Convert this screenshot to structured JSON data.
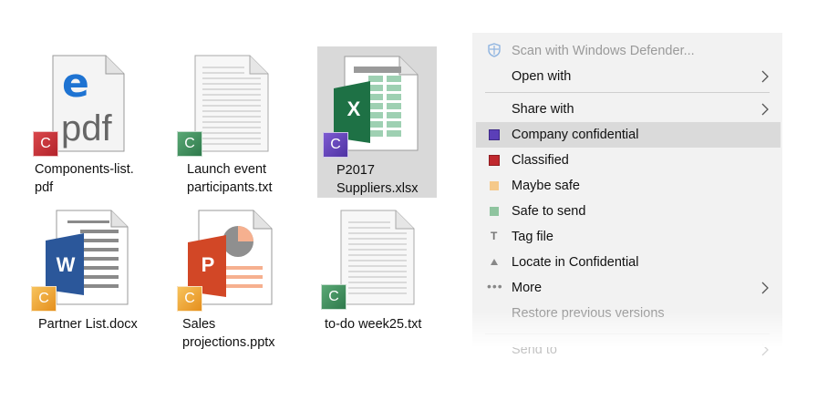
{
  "files": [
    {
      "name": "Components-list.\npdf",
      "badge": "C",
      "badge_color": "#c0282e",
      "type": "pdf",
      "pdf_text": "pdf",
      "selected": false
    },
    {
      "name": "Launch event\nparticipants.txt",
      "badge": "C",
      "badge_color": "#3c8a58",
      "type": "txt",
      "selected": false
    },
    {
      "name": "P2017\nSuppliers.xlsx",
      "badge": "C",
      "badge_color": "#5b3fb8",
      "type": "xlsx",
      "app_letter": "X",
      "selected": true
    },
    {
      "name": "Partner List.docx",
      "badge": "C",
      "badge_color": "#ee9f2a",
      "type": "docx",
      "app_letter": "W",
      "selected": false
    },
    {
      "name": "Sales\nprojections.pptx",
      "badge": "C",
      "badge_color": "#ee9f2a",
      "type": "pptx",
      "app_letter": "P",
      "selected": false
    },
    {
      "name": "to-do week25.txt",
      "badge": "C",
      "badge_color": "#3c8a58",
      "type": "txt",
      "selected": false
    }
  ],
  "context_menu": {
    "items": [
      {
        "label": "Scan with Windows Defender...",
        "icon": "defender-shield-icon",
        "disabled": true
      },
      {
        "label": "Open with",
        "submenu": true
      },
      {
        "label": "Share with",
        "submenu": true
      },
      {
        "label": "Company confidential",
        "icon": "label-square-icon",
        "color": "#5b3fb8",
        "highlighted": true
      },
      {
        "label": "Classified",
        "icon": "label-square-icon",
        "color": "#c0282e"
      },
      {
        "label": "Maybe safe",
        "icon": "label-square-icon",
        "color": "#f5c98a"
      },
      {
        "label": "Safe to send",
        "icon": "label-square-icon",
        "color": "#8fc49f"
      },
      {
        "label": "Tag file",
        "icon": "tag-t-icon"
      },
      {
        "label": "Locate in Confidential",
        "icon": "locate-triangle-icon"
      },
      {
        "label": "More",
        "icon": "ellipsis-icon",
        "submenu": true
      },
      {
        "label": "Restore previous versions",
        "disabled": true
      },
      {
        "label": "Send to",
        "submenu": true,
        "faded": true
      }
    ]
  }
}
